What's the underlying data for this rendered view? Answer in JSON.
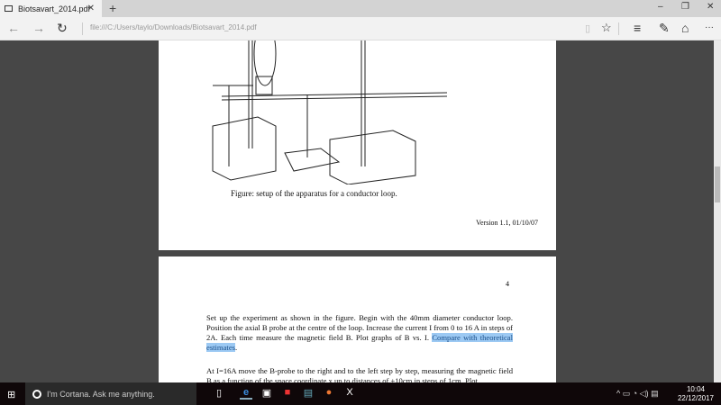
{
  "tab": {
    "title": "Biotsavart_2014.pdf",
    "close": "✕",
    "new": "+"
  },
  "window": {
    "minimize": "–",
    "restore": "❐",
    "close": "✕"
  },
  "nav": {
    "back": "←",
    "forward": "→",
    "refresh": "↻",
    "url": "file:///C:/Users/taylo/Downloads/Biotsavart_2014.pdf",
    "reading": "▯",
    "favorite": "☆",
    "hub": "≡",
    "note": "✎",
    "share": "⌂",
    "more": "···"
  },
  "page1": {
    "caption": "Figure: setup of the apparatus for a conductor loop.",
    "version": "Version 1.1, 01/10/07"
  },
  "page2": {
    "number": "4",
    "para1_a": "Set up the experiment as shown in the figure.  Begin with the 40mm diameter conductor loop. Position the axial B probe at the centre of the loop.  Increase the current I from 0 to 16 A in steps of 2A.  Each time measure the magnetic field B. Plot graphs of B vs. I. ",
    "para1_hl": "Compare with theoretical estimates",
    "para1_b": ".",
    "para2": "At I=16A move the B-probe to the right and to the left step by step, measuring the magnetic field B as a function of the space coordinate x up to distances of ±10cm in steps of 1cm. Plot"
  },
  "taskbar": {
    "start": "⊞",
    "cortana": "I'm Cortana. Ask me anything.",
    "tray": "^ ▭ ◔ ◁) ▤",
    "time": "10:04",
    "date": "22/12/2017"
  }
}
